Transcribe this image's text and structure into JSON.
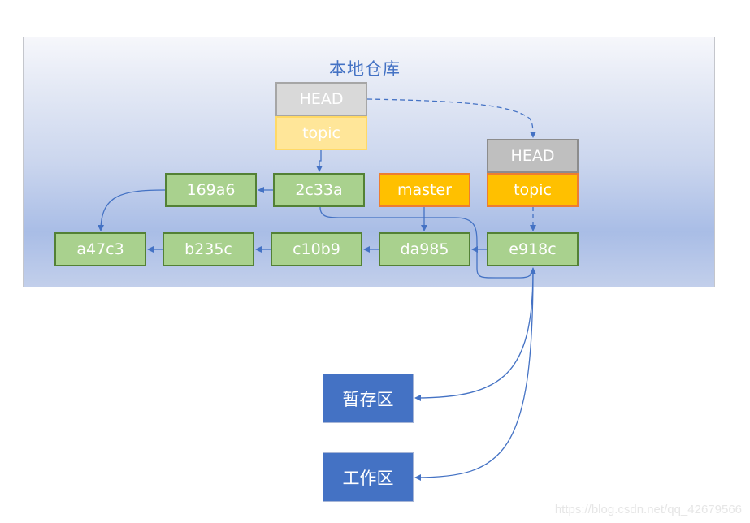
{
  "repository": {
    "title": "本地仓库",
    "commits": [
      {
        "id": "a47c3"
      },
      {
        "id": "b235c"
      },
      {
        "id": "c10b9"
      },
      {
        "id": "da985"
      },
      {
        "id": "e918c"
      },
      {
        "id": "169a6"
      },
      {
        "id": "2c33a"
      }
    ],
    "branches": {
      "master": "master",
      "topic_old": "topic",
      "topic_new": "topic"
    },
    "heads": {
      "head_old": "HEAD",
      "head_new": "HEAD"
    }
  },
  "areas": {
    "staging": "暂存区",
    "working": "工作区"
  },
  "edges": [
    {
      "from": "169a6",
      "to": "a47c3",
      "style": "solid"
    },
    {
      "from": "2c33a",
      "to": "169a6",
      "style": "solid"
    },
    {
      "from": "b235c",
      "to": "a47c3",
      "style": "solid"
    },
    {
      "from": "c10b9",
      "to": "b235c",
      "style": "solid"
    },
    {
      "from": "da985",
      "to": "c10b9",
      "style": "solid"
    },
    {
      "from": "e918c",
      "to": "da985",
      "style": "solid"
    },
    {
      "from": "master",
      "to": "da985",
      "style": "solid"
    },
    {
      "from": "topic_old",
      "to": "2c33a",
      "style": "solid"
    },
    {
      "from": "topic_new",
      "to": "e918c",
      "style": "dashed"
    },
    {
      "from": "head_old",
      "to": "head_new",
      "style": "dashed"
    },
    {
      "from": "2c33a",
      "to": "e918c",
      "style": "solid"
    },
    {
      "from": "e918c",
      "to": "staging",
      "style": "solid"
    },
    {
      "from": "e918c",
      "to": "working",
      "style": "solid"
    }
  ],
  "colors": {
    "commit_fill": "#a9d18e",
    "commit_border": "#538135",
    "branch_fill": "#ffc000",
    "branch_border": "#ed7d31",
    "head_fill": "#bfbfbf",
    "area_fill": "#4472c4",
    "link": "#4472c4"
  },
  "watermark": "https://blog.csdn.net/qq_42679566"
}
